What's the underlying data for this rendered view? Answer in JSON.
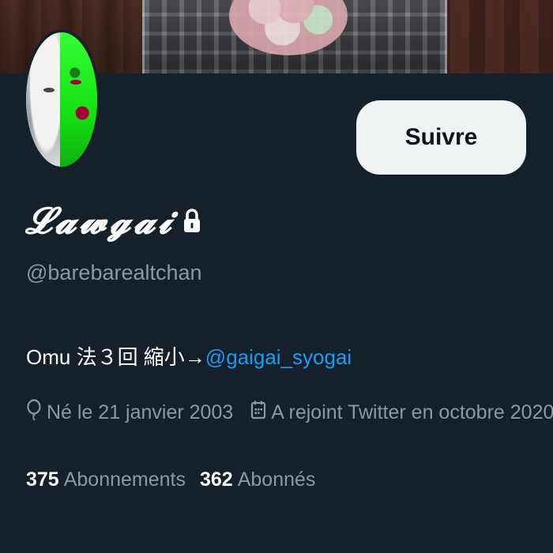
{
  "profile": {
    "display_name": "𝓛𝓪𝔀𝓰𝓪𝓲",
    "handle": "@barebarealtchan",
    "protected_icon": "lock-icon",
    "follow_button_label": "Suivre",
    "bio": {
      "text": "Omu 法３回 縮小→",
      "mention": "@gaigai_syogai"
    },
    "meta": {
      "birth": "Né le 21 janvier 2003",
      "birth_icon": "balloon-icon",
      "joined": "A rejoint Twitter en octobre 2020",
      "joined_icon": "calendar-icon"
    },
    "stats": {
      "following_count": "375",
      "following_label": "Abonnements",
      "followers_count": "362",
      "followers_label": "Abonnés"
    }
  },
  "colors": {
    "background": "#15202b",
    "secondary_text": "#8b98a5",
    "link": "#1d9bf0",
    "button_bg": "#eff3f4"
  }
}
